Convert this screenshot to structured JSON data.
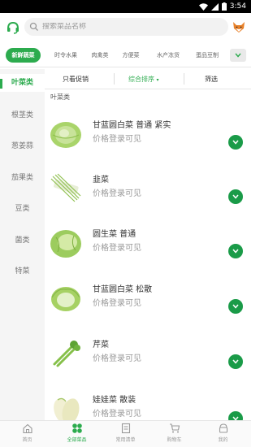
{
  "status_bar": {
    "time": "3:54"
  },
  "search": {
    "placeholder": "搜索菜品名称"
  },
  "categories": [
    {
      "label": "新鲜蔬菜",
      "active": true
    },
    {
      "label": "时令水果",
      "active": false
    },
    {
      "label": "肉禽类",
      "active": false
    },
    {
      "label": "方便菜",
      "active": false
    },
    {
      "label": "水产冻货",
      "active": false
    },
    {
      "label": "蛋品豆制",
      "active": false
    }
  ],
  "sidebar": [
    {
      "label": "叶菜类",
      "active": true
    },
    {
      "label": "根茎类",
      "active": false
    },
    {
      "label": "葱姜蒜",
      "active": false
    },
    {
      "label": "茄果类",
      "active": false
    },
    {
      "label": "豆类",
      "active": false
    },
    {
      "label": "菌类",
      "active": false
    },
    {
      "label": "特菜",
      "active": false
    }
  ],
  "filter": {
    "promo": "只看促销",
    "sort": "综合排序",
    "sort_arrow": "▾",
    "filter": "筛选"
  },
  "section_title": "叶菜类",
  "products": [
    {
      "name": "甘蓝圆白菜 普通 紧实",
      "price": "价格登录可见",
      "image": "cabbage"
    },
    {
      "name": "韭菜",
      "price": "价格登录可见",
      "image": "chives"
    },
    {
      "name": "圆生菜 普通",
      "price": "价格登录可见",
      "image": "lettuce"
    },
    {
      "name": "甘蓝圆白菜 松散",
      "price": "价格登录可见",
      "image": "cabbage-loose"
    },
    {
      "name": "芹菜",
      "price": "价格登录可见",
      "image": "celery"
    },
    {
      "name": "娃娃菜 散装",
      "price": "价格登录可见",
      "image": "baby-cabbage"
    }
  ],
  "tabbar": [
    {
      "label": "首页",
      "icon": "home-icon",
      "active": false
    },
    {
      "label": "全部菜品",
      "icon": "grid-icon",
      "active": true
    },
    {
      "label": "常用清单",
      "icon": "list-icon",
      "active": false
    },
    {
      "label": "购物车",
      "icon": "cart-icon",
      "active": false
    },
    {
      "label": "我的",
      "icon": "profile-icon",
      "active": false
    }
  ],
  "colors": {
    "accent": "#2cab4e",
    "add_button": "#1a9b48"
  }
}
